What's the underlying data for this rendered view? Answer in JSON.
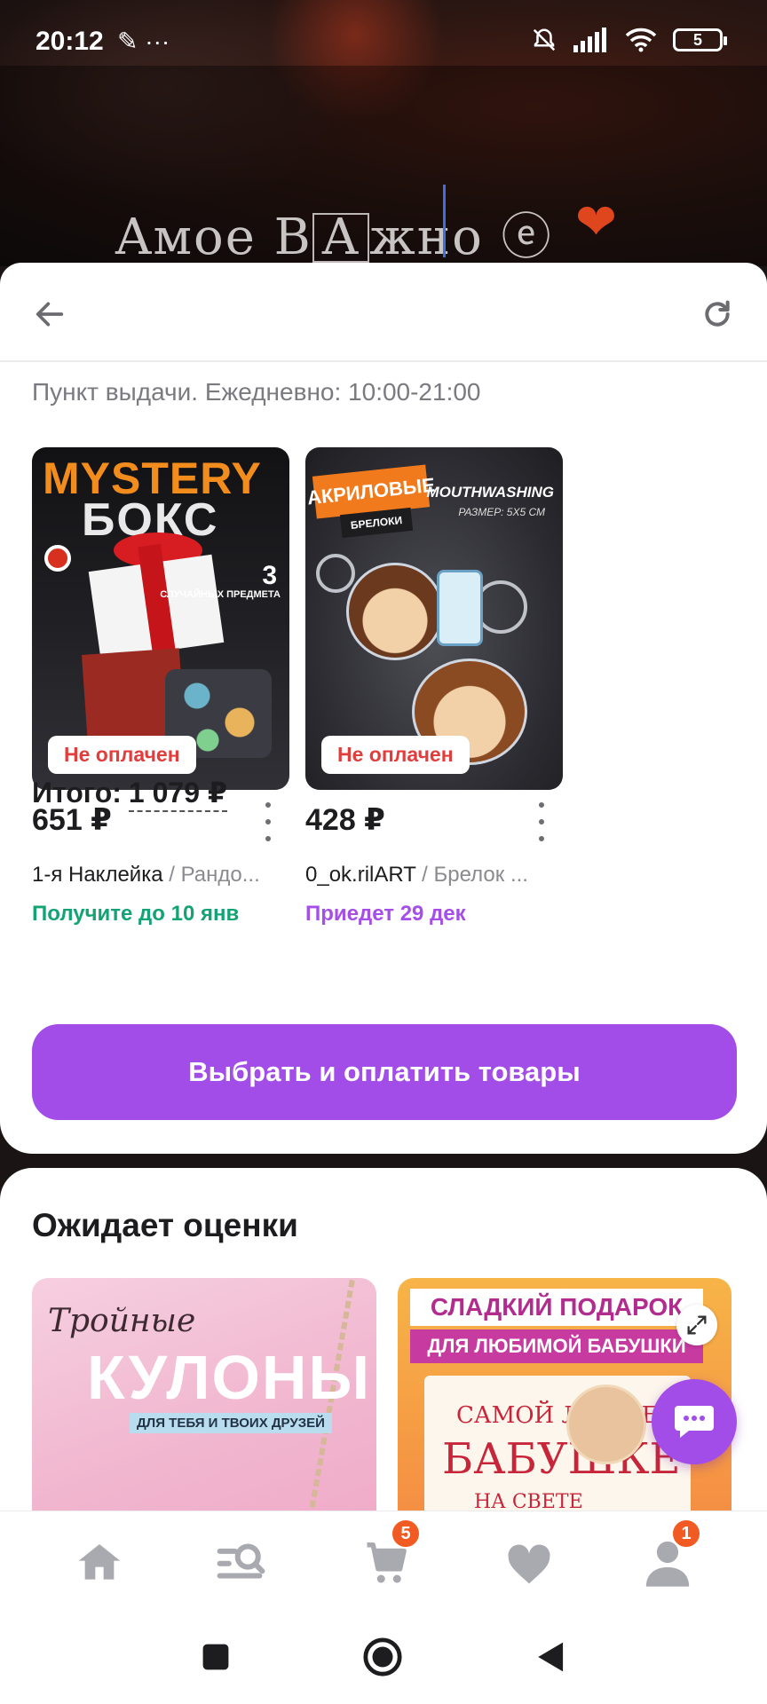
{
  "status_bar": {
    "time": "20:12",
    "extra_icons": "···",
    "battery": "5"
  },
  "background": {
    "overlay_text_pre": "Aмое В",
    "overlay_text_boxed": "А",
    "overlay_text_post": "жно",
    "overlay_text_end": "ⓔ",
    "overlay_heart": "❤"
  },
  "header": {
    "back_icon": "arrow-left-icon",
    "refresh_icon": "refresh-icon"
  },
  "order": {
    "pickup_info": "Пункт выдачи. Ежедневно: 10:00-21:00",
    "products": [
      {
        "art_title_1": "MYSTERY",
        "art_title_2": "БОКС",
        "art_count": "3",
        "art_count_text": "СЛУЧАЙНЫХ ПРЕДМЕТА",
        "badge": "Не оплачен",
        "price": "651 ₽",
        "seller": "1-я Наклейка",
        "product_name": " / Рандо...",
        "delivery": "Получите до 10 янв",
        "delivery_color": "#14a375"
      },
      {
        "art_tag": "АКРИЛОВЫЕ",
        "art_tag2": "БРЕЛОКИ",
        "art_brand": "MOUTHWASHING",
        "art_size": "РАЗМЕР: 5Х5 СМ",
        "badge": "Не оплачен",
        "price": "428 ₽",
        "seller": "0_ok.rilART",
        "product_name": " / Брелок ...",
        "delivery": "Приедет 29 дек",
        "delivery_color": "#a64ee8"
      }
    ],
    "total_label": "Итого:",
    "total_value": "1 079 ₽",
    "pay_button": "Выбрать и оплатить товары"
  },
  "awaiting_review": {
    "title": "Ожидает оценки",
    "items": [
      {
        "art_script": "Тройные",
        "art_big": "КУЛОНЫ",
        "art_sub": "ДЛЯ ТЕБЯ И ТВОИХ ДРУЗЕЙ"
      },
      {
        "art_line1": "СЛАДКИЙ ПОДАРОК",
        "art_line2": "ДЛЯ ЛЮБИМОЙ БАБУШКИ",
        "card_l1": "САМОЙ ЛУЧШЕЙ",
        "card_l2": "БАБУШКЕ",
        "card_l3": "НА СВЕТЕ"
      }
    ]
  },
  "tab_bar": {
    "tabs": [
      {
        "icon": "home-icon"
      },
      {
        "icon": "catalog-search-icon"
      },
      {
        "icon": "cart-icon",
        "badge": "5"
      },
      {
        "icon": "heart-icon"
      },
      {
        "icon": "profile-icon",
        "badge": "1"
      }
    ]
  },
  "colors": {
    "accent": "#a24de8",
    "badge": "#f15a22",
    "unpaid": "#e23d3d"
  }
}
